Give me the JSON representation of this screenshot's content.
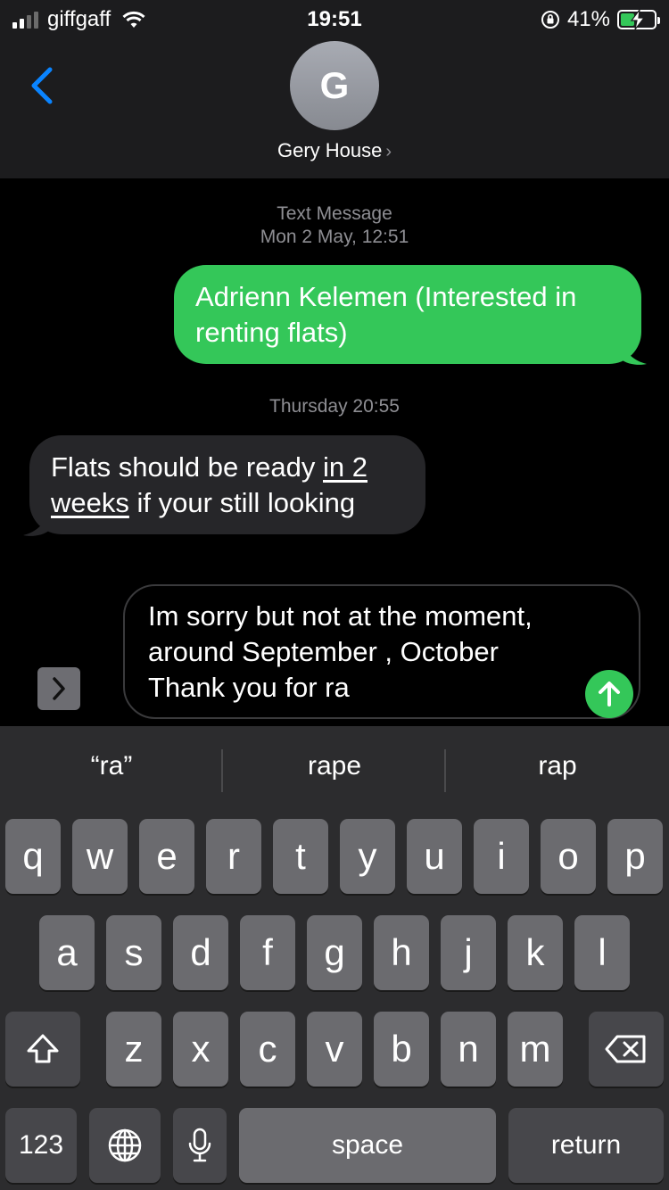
{
  "status_bar": {
    "carrier": "giffgaff",
    "time": "19:51",
    "battery": "41%",
    "battery_level": 0.41,
    "icons": [
      "signal-icon",
      "wifi-icon",
      "orientation-lock-icon",
      "battery-charging-icon"
    ]
  },
  "header": {
    "back_icon": "chevron-left-icon",
    "avatar_initial": "G",
    "contact_name": "Gery House",
    "contact_chevron": "›"
  },
  "messages": {
    "timestamp1_line1": "Text Message",
    "timestamp1_line2": "Mon 2 May, 12:51",
    "sent_text": "Adrienn Kelemen (Interested in renting flats)",
    "timestamp2": "Thursday 20:55",
    "recv_before": "Flats should be ready ",
    "recv_link": "in 2 weeks",
    "recv_after": " if your still looking"
  },
  "compose": {
    "text": "Im sorry but not at the moment, around September , October Thank you for ra",
    "apps_icon": "chevron-right-icon",
    "send_icon": "arrow-up-icon"
  },
  "keyboard": {
    "predictions": [
      "“ra”",
      "rape",
      "rap"
    ],
    "row1": [
      "q",
      "w",
      "e",
      "r",
      "t",
      "y",
      "u",
      "i",
      "o",
      "p"
    ],
    "row2": [
      "a",
      "s",
      "d",
      "f",
      "g",
      "h",
      "j",
      "k",
      "l"
    ],
    "row3": [
      "z",
      "x",
      "c",
      "v",
      "b",
      "n",
      "m"
    ],
    "numbers_label": "123",
    "space_label": "space",
    "return_label": "return",
    "icons": [
      "shift-icon",
      "delete-icon",
      "globe-icon",
      "microphone-icon"
    ]
  },
  "colors": {
    "sent_bubble": "#34c759",
    "received_bubble": "#262629",
    "accent_blue": "#0a84ff",
    "keyboard_bg": "#2c2c2e",
    "key": "#6b6b6f"
  }
}
